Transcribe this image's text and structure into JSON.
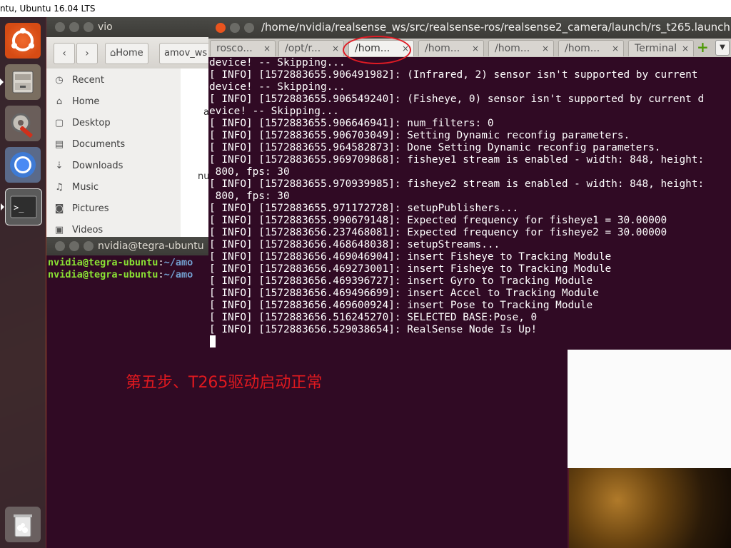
{
  "system_bar": {
    "title": "ntu, Ubuntu 16.04 LTS"
  },
  "launcher": {
    "items": [
      {
        "name": "ubuntu-dash-icon"
      },
      {
        "name": "file-manager-icon"
      },
      {
        "name": "system-settings-icon"
      },
      {
        "name": "chromium-icon"
      },
      {
        "name": "terminal-icon"
      },
      {
        "name": "trash-icon"
      }
    ]
  },
  "files": {
    "title": "vio",
    "nav": {
      "back": "‹",
      "forward": "›"
    },
    "crumbs": [
      "Home",
      "amov_ws"
    ],
    "sidebar": [
      {
        "label": "Recent",
        "icon": "clock-icon",
        "glyph": "◷"
      },
      {
        "label": "Home",
        "icon": "home-icon",
        "glyph": "⌂"
      },
      {
        "label": "Desktop",
        "icon": "desktop-icon",
        "glyph": "▢"
      },
      {
        "label": "Documents",
        "icon": "documents-icon",
        "glyph": "▤"
      },
      {
        "label": "Downloads",
        "icon": "downloads-icon",
        "glyph": "⇣"
      },
      {
        "label": "Music",
        "icon": "music-icon",
        "glyph": "♫"
      },
      {
        "label": "Pictures",
        "icon": "pictures-icon",
        "glyph": "◙"
      },
      {
        "label": "Videos",
        "icon": "videos-icon",
        "glyph": "▣"
      }
    ],
    "partial_text": [
      "a",
      "nu"
    ]
  },
  "terminal_back": {
    "title": "nvidia@tegra-ubuntu",
    "lines": [
      {
        "user": "nvidia@tegra-ubuntu",
        "sep": ":",
        "path": "~/amo"
      },
      {
        "user": "nvidia@tegra-ubuntu",
        "sep": ":",
        "path": "~/amo"
      }
    ]
  },
  "terminal": {
    "title": "/home/nvidia/realsense_ws/src/realsense-ros/realsense2_camera/launch/rs_t265.launch",
    "tabs": [
      {
        "label": "rosco...",
        "active": false
      },
      {
        "label": "/opt/r...",
        "active": false
      },
      {
        "label": "/hom...",
        "active": true
      },
      {
        "label": "/hom...",
        "active": false
      },
      {
        "label": "/hom...",
        "active": false
      },
      {
        "label": "/hom...",
        "active": false
      },
      {
        "label": "Terminal",
        "active": false
      }
    ],
    "tab_close": "×",
    "add_tab": "+",
    "menu": "▼",
    "output": [
      "device! -- Skipping...",
      "[ INFO] [1572883655.906491982]: (Infrared, 2) sensor isn't supported by current",
      "device! -- Skipping...",
      "[ INFO] [1572883655.906549240]: (Fisheye, 0) sensor isn't supported by current d",
      "evice! -- Skipping...",
      "[ INFO] [1572883655.906646941]: num_filters: 0",
      "[ INFO] [1572883655.906703049]: Setting Dynamic reconfig parameters.",
      "[ INFO] [1572883655.964582873]: Done Setting Dynamic reconfig parameters.",
      "[ INFO] [1572883655.969709868]: fisheye1 stream is enabled - width: 848, height:",
      " 800, fps: 30",
      "[ INFO] [1572883655.970939985]: fisheye2 stream is enabled - width: 848, height:",
      " 800, fps: 30",
      "[ INFO] [1572883655.971172728]: setupPublishers...",
      "[ INFO] [1572883655.990679148]: Expected frequency for fisheye1 = 30.00000",
      "[ INFO] [1572883656.237468081]: Expected frequency for fisheye2 = 30.00000",
      "[ INFO] [1572883656.468648038]: setupStreams...",
      "[ INFO] [1572883656.469046904]: insert Fisheye to Tracking Module",
      "[ INFO] [1572883656.469273001]: insert Fisheye to Tracking Module",
      "[ INFO] [1572883656.469396727]: insert Gyro to Tracking Module",
      "[ INFO] [1572883656.469496699]: insert Accel to Tracking Module",
      "[ INFO] [1572883656.469600924]: insert Pose to Tracking Module",
      "[ INFO] [1572883656.516245270]: SELECTED BASE:Pose, 0",
      "[ INFO] [1572883656.529038654]: RealSense Node Is Up!"
    ]
  },
  "annotation": {
    "text": "第五步、T265驱动启动正常"
  },
  "colors": {
    "terminal_bg": "#300a24",
    "prompt_user": "#8ae234",
    "prompt_path": "#729fcf",
    "annotation": "#e0191f",
    "highlight_circle": "#e01b24"
  }
}
